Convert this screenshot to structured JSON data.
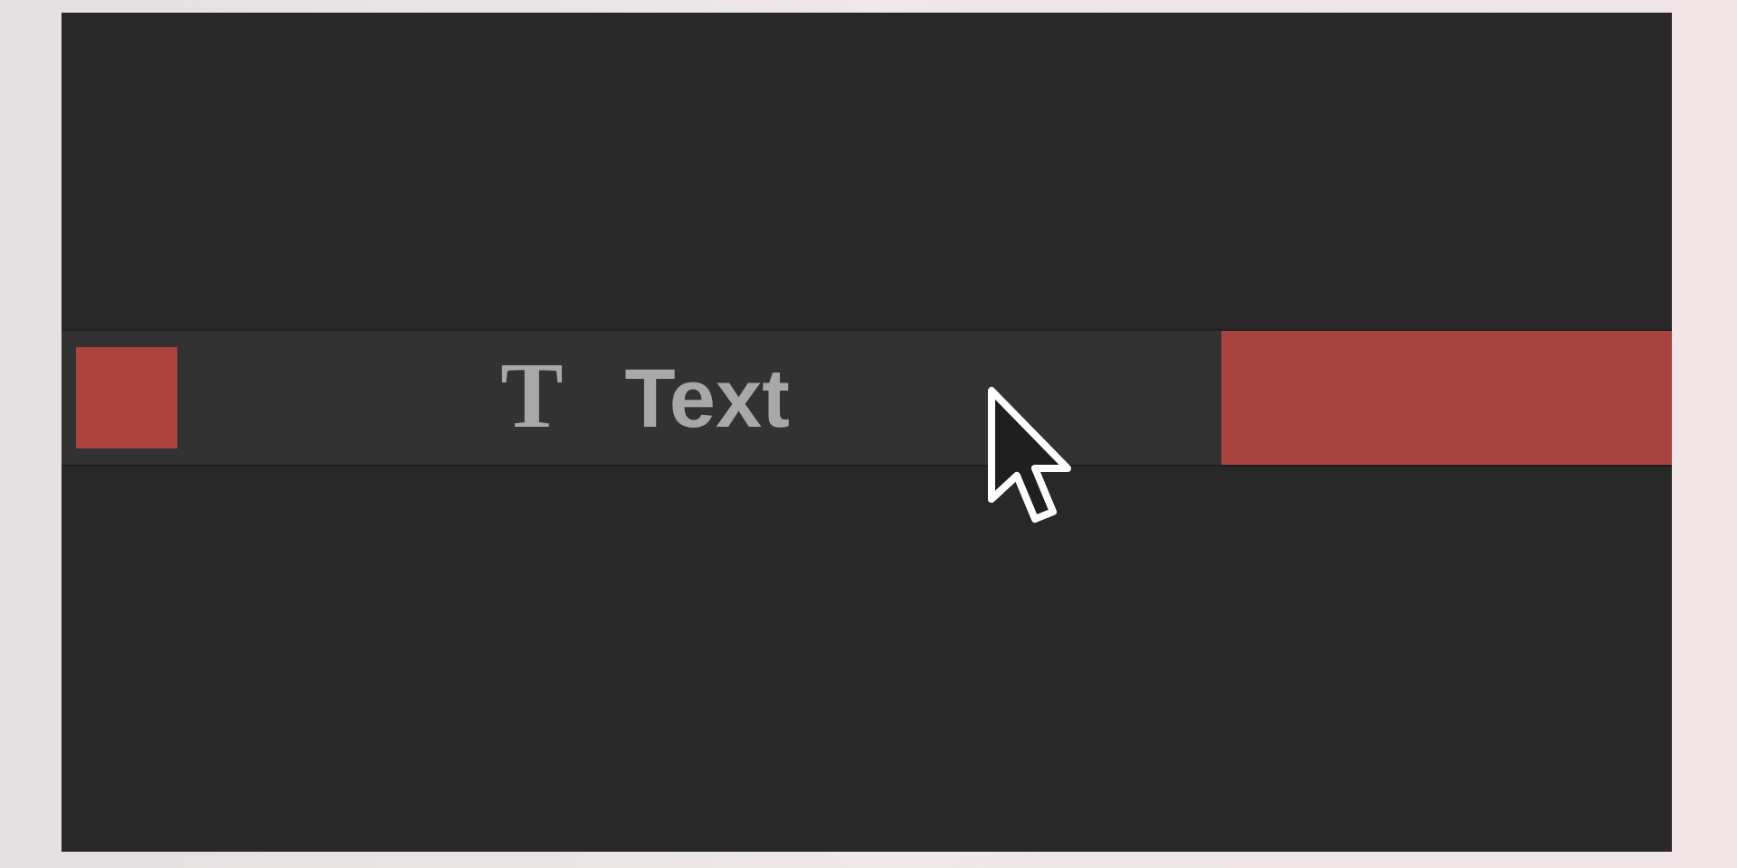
{
  "track": {
    "icon": "T",
    "label": "Text"
  }
}
